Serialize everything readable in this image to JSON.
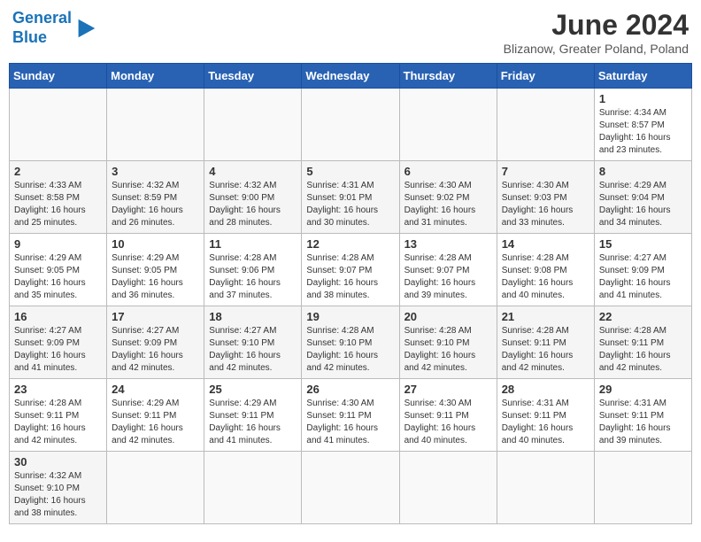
{
  "header": {
    "logo_general": "General",
    "logo_blue": "Blue",
    "month_title": "June 2024",
    "subtitle": "Blizanow, Greater Poland, Poland"
  },
  "weekdays": [
    "Sunday",
    "Monday",
    "Tuesday",
    "Wednesday",
    "Thursday",
    "Friday",
    "Saturday"
  ],
  "rows": [
    {
      "cells": [
        {
          "day": "",
          "info": ""
        },
        {
          "day": "",
          "info": ""
        },
        {
          "day": "",
          "info": ""
        },
        {
          "day": "",
          "info": ""
        },
        {
          "day": "",
          "info": ""
        },
        {
          "day": "",
          "info": ""
        },
        {
          "day": "1",
          "info": "Sunrise: 4:34 AM\nSunset: 8:57 PM\nDaylight: 16 hours\nand 23 minutes."
        }
      ]
    },
    {
      "cells": [
        {
          "day": "2",
          "info": "Sunrise: 4:33 AM\nSunset: 8:58 PM\nDaylight: 16 hours\nand 25 minutes."
        },
        {
          "day": "3",
          "info": "Sunrise: 4:32 AM\nSunset: 8:59 PM\nDaylight: 16 hours\nand 26 minutes."
        },
        {
          "day": "4",
          "info": "Sunrise: 4:32 AM\nSunset: 9:00 PM\nDaylight: 16 hours\nand 28 minutes."
        },
        {
          "day": "5",
          "info": "Sunrise: 4:31 AM\nSunset: 9:01 PM\nDaylight: 16 hours\nand 30 minutes."
        },
        {
          "day": "6",
          "info": "Sunrise: 4:30 AM\nSunset: 9:02 PM\nDaylight: 16 hours\nand 31 minutes."
        },
        {
          "day": "7",
          "info": "Sunrise: 4:30 AM\nSunset: 9:03 PM\nDaylight: 16 hours\nand 33 minutes."
        },
        {
          "day": "8",
          "info": "Sunrise: 4:29 AM\nSunset: 9:04 PM\nDaylight: 16 hours\nand 34 minutes."
        }
      ]
    },
    {
      "cells": [
        {
          "day": "9",
          "info": "Sunrise: 4:29 AM\nSunset: 9:05 PM\nDaylight: 16 hours\nand 35 minutes."
        },
        {
          "day": "10",
          "info": "Sunrise: 4:29 AM\nSunset: 9:05 PM\nDaylight: 16 hours\nand 36 minutes."
        },
        {
          "day": "11",
          "info": "Sunrise: 4:28 AM\nSunset: 9:06 PM\nDaylight: 16 hours\nand 37 minutes."
        },
        {
          "day": "12",
          "info": "Sunrise: 4:28 AM\nSunset: 9:07 PM\nDaylight: 16 hours\nand 38 minutes."
        },
        {
          "day": "13",
          "info": "Sunrise: 4:28 AM\nSunset: 9:07 PM\nDaylight: 16 hours\nand 39 minutes."
        },
        {
          "day": "14",
          "info": "Sunrise: 4:28 AM\nSunset: 9:08 PM\nDaylight: 16 hours\nand 40 minutes."
        },
        {
          "day": "15",
          "info": "Sunrise: 4:27 AM\nSunset: 9:09 PM\nDaylight: 16 hours\nand 41 minutes."
        }
      ]
    },
    {
      "cells": [
        {
          "day": "16",
          "info": "Sunrise: 4:27 AM\nSunset: 9:09 PM\nDaylight: 16 hours\nand 41 minutes."
        },
        {
          "day": "17",
          "info": "Sunrise: 4:27 AM\nSunset: 9:09 PM\nDaylight: 16 hours\nand 42 minutes."
        },
        {
          "day": "18",
          "info": "Sunrise: 4:27 AM\nSunset: 9:10 PM\nDaylight: 16 hours\nand 42 minutes."
        },
        {
          "day": "19",
          "info": "Sunrise: 4:28 AM\nSunset: 9:10 PM\nDaylight: 16 hours\nand 42 minutes."
        },
        {
          "day": "20",
          "info": "Sunrise: 4:28 AM\nSunset: 9:10 PM\nDaylight: 16 hours\nand 42 minutes."
        },
        {
          "day": "21",
          "info": "Sunrise: 4:28 AM\nSunset: 9:11 PM\nDaylight: 16 hours\nand 42 minutes."
        },
        {
          "day": "22",
          "info": "Sunrise: 4:28 AM\nSunset: 9:11 PM\nDaylight: 16 hours\nand 42 minutes."
        }
      ]
    },
    {
      "cells": [
        {
          "day": "23",
          "info": "Sunrise: 4:28 AM\nSunset: 9:11 PM\nDaylight: 16 hours\nand 42 minutes."
        },
        {
          "day": "24",
          "info": "Sunrise: 4:29 AM\nSunset: 9:11 PM\nDaylight: 16 hours\nand 42 minutes."
        },
        {
          "day": "25",
          "info": "Sunrise: 4:29 AM\nSunset: 9:11 PM\nDaylight: 16 hours\nand 41 minutes."
        },
        {
          "day": "26",
          "info": "Sunrise: 4:30 AM\nSunset: 9:11 PM\nDaylight: 16 hours\nand 41 minutes."
        },
        {
          "day": "27",
          "info": "Sunrise: 4:30 AM\nSunset: 9:11 PM\nDaylight: 16 hours\nand 40 minutes."
        },
        {
          "day": "28",
          "info": "Sunrise: 4:31 AM\nSunset: 9:11 PM\nDaylight: 16 hours\nand 40 minutes."
        },
        {
          "day": "29",
          "info": "Sunrise: 4:31 AM\nSunset: 9:11 PM\nDaylight: 16 hours\nand 39 minutes."
        }
      ]
    },
    {
      "cells": [
        {
          "day": "30",
          "info": "Sunrise: 4:32 AM\nSunset: 9:10 PM\nDaylight: 16 hours\nand 38 minutes."
        },
        {
          "day": "",
          "info": ""
        },
        {
          "day": "",
          "info": ""
        },
        {
          "day": "",
          "info": ""
        },
        {
          "day": "",
          "info": ""
        },
        {
          "day": "",
          "info": ""
        },
        {
          "day": "",
          "info": ""
        }
      ]
    }
  ]
}
